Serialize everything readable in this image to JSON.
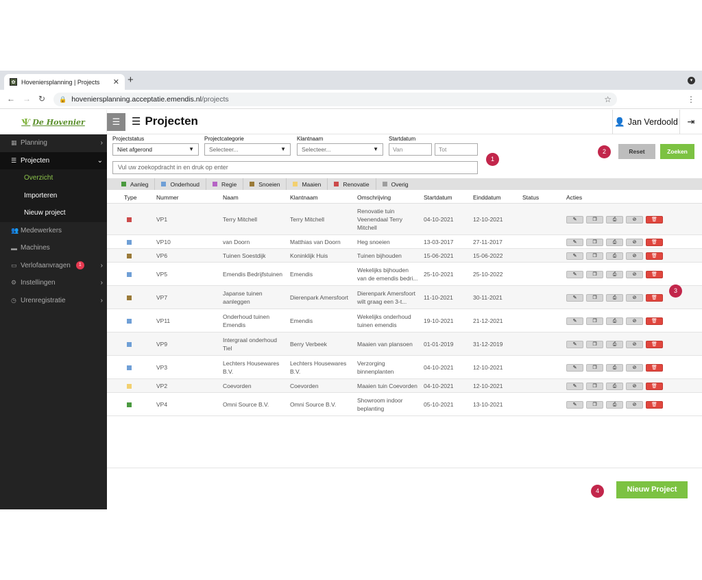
{
  "browser": {
    "tab_title": "Hoveniersplanning | Projects",
    "tab_close": "✕",
    "new_tab": "+",
    "url_host": "hoveniersplanning.acceptatie.emendis.nl",
    "url_path": "/projects"
  },
  "logo": {
    "text": "De Hovenier"
  },
  "sidebar": {
    "items": [
      {
        "label": "Planning",
        "icon": "calendar-icon"
      },
      {
        "label": "Projecten",
        "icon": "table-icon"
      },
      {
        "label": "Medewerkers",
        "icon": "users-icon"
      },
      {
        "label": "Machines",
        "icon": "truck-icon"
      },
      {
        "label": "Verlofaanvragen",
        "icon": "plane-icon",
        "badge": "1"
      },
      {
        "label": "Instellingen",
        "icon": "cogs-icon"
      },
      {
        "label": "Urenregistratie",
        "icon": "clock-icon"
      }
    ],
    "sub_items": [
      "Overzicht",
      "Importeren",
      "Nieuw project"
    ]
  },
  "header": {
    "title": "Projecten",
    "user": "Jan Verdoold"
  },
  "filters": {
    "status_label": "Projectstatus",
    "status_value": "Niet afgerond",
    "category_label": "Projectcategorie",
    "category_placeholder": "Selecteer...",
    "client_label": "Klantnaam",
    "client_placeholder": "Selecteer...",
    "start_label": "Startdatum",
    "from_placeholder": "Van",
    "to_placeholder": "Tot",
    "search_placeholder": "Vul uw zoekopdracht in en druk op enter",
    "reset_label": "Reset",
    "search_label": "Zoeken"
  },
  "markers": [
    "1",
    "2",
    "3",
    "4"
  ],
  "legend": [
    {
      "label": "Aanleg",
      "color": "#4a9a3f"
    },
    {
      "label": "Onderhoud",
      "color": "#6f9fd6"
    },
    {
      "label": "Regie",
      "color": "#b563c4"
    },
    {
      "label": "Snoeien",
      "color": "#9a7a38"
    },
    {
      "label": "Maaien",
      "color": "#f2d070"
    },
    {
      "label": "Renovatie",
      "color": "#cc4a4a"
    },
    {
      "label": "Overig",
      "color": "#9e9e9e"
    }
  ],
  "table": {
    "headers": [
      "Type",
      "Nummer",
      "Naam",
      "Klantnaam",
      "Omschrijving",
      "Startdatum",
      "Einddatum",
      "Status",
      "Acties"
    ],
    "rows": [
      {
        "color": "#cc4a4a",
        "nummer": "VP1",
        "naam": [
          "Terry Mitchell"
        ],
        "klant": [
          "Terry Mitchell"
        ],
        "omschrijving": [
          "Renovatie tuin",
          "Veenendaal Terry",
          "Mitchell"
        ],
        "start": "04-10-2021",
        "eind": "12-10-2021",
        "status": ""
      },
      {
        "color": "#6f9fd6",
        "nummer": "VP10",
        "naam": [
          "van Doorn"
        ],
        "klant": [
          "Matthias van Doorn"
        ],
        "omschrijving": [
          "Heg snoeien"
        ],
        "start": "13-03-2017",
        "eind": "27-11-2017",
        "status": ""
      },
      {
        "color": "#9a7a38",
        "nummer": "VP6",
        "naam": [
          "Tuinen Soestdijk"
        ],
        "klant": [
          "Koninklijk Huis"
        ],
        "omschrijving": [
          "Tuinen bijhouden"
        ],
        "start": "15-06-2021",
        "eind": "15-06-2022",
        "status": ""
      },
      {
        "color": "#6f9fd6",
        "nummer": "VP5",
        "naam": [
          "Emendis Bedrijfstuinen"
        ],
        "klant": [
          "Emendis"
        ],
        "omschrijving": [
          "Wekelijks bijhouden",
          "van de emendis bedri..."
        ],
        "start": "25-10-2021",
        "eind": "25-10-2022",
        "status": ""
      },
      {
        "color": "#9a7a38",
        "nummer": "VP7",
        "naam": [
          "Japanse tuinen",
          "aanleggen"
        ],
        "klant": [
          "Dierenpark Amersfoort"
        ],
        "omschrijving": [
          "Dierenpark Amersfoort",
          "wilt graag een 3-t..."
        ],
        "start": "11-10-2021",
        "eind": "30-11-2021",
        "status": ""
      },
      {
        "color": "#6f9fd6",
        "nummer": "VP11",
        "naam": [
          "Onderhoud tuinen",
          "Emendis"
        ],
        "klant": [
          "Emendis"
        ],
        "omschrijving": [
          "Wekelijks onderhoud",
          "tuinen emendis"
        ],
        "start": "19-10-2021",
        "eind": "21-12-2021",
        "status": ""
      },
      {
        "color": "#6f9fd6",
        "nummer": "VP9",
        "naam": [
          "Intergraal onderhoud",
          "Tiel"
        ],
        "klant": [
          "Berry Verbeek"
        ],
        "omschrijving": [
          "Maaien van plansoen"
        ],
        "start": "01-01-2019",
        "eind": "31-12-2019",
        "status": ""
      },
      {
        "color": "#6f9fd6",
        "nummer": "VP3",
        "naam": [
          "Lechters Housewares",
          "B.V."
        ],
        "klant": [
          "Lechters Housewares",
          "B.V."
        ],
        "omschrijving": [
          "Verzorging",
          "binnenplanten"
        ],
        "start": "04-10-2021",
        "eind": "12-10-2021",
        "status": ""
      },
      {
        "color": "#f2d070",
        "nummer": "VP2",
        "naam": [
          "Coevorden"
        ],
        "klant": [
          "Coevorden"
        ],
        "omschrijving": [
          "Maaien tuin Coevorden"
        ],
        "start": "04-10-2021",
        "eind": "12-10-2021",
        "status": ""
      },
      {
        "color": "#4a9a3f",
        "nummer": "VP4",
        "naam": [
          "Omni Source B.V."
        ],
        "klant": [
          "Omni Source B.V."
        ],
        "omschrijving": [
          "Showroom indoor",
          "beplanting"
        ],
        "start": "05-10-2021",
        "eind": "13-10-2021",
        "status": ""
      }
    ],
    "actions": [
      {
        "name": "edit",
        "glyph": "✎"
      },
      {
        "name": "copy",
        "glyph": "❐"
      },
      {
        "name": "print",
        "glyph": "⎙"
      },
      {
        "name": "block",
        "glyph": "⊘"
      },
      {
        "name": "delete",
        "glyph": "🗑"
      }
    ]
  },
  "new_project_label": "Nieuw Project"
}
